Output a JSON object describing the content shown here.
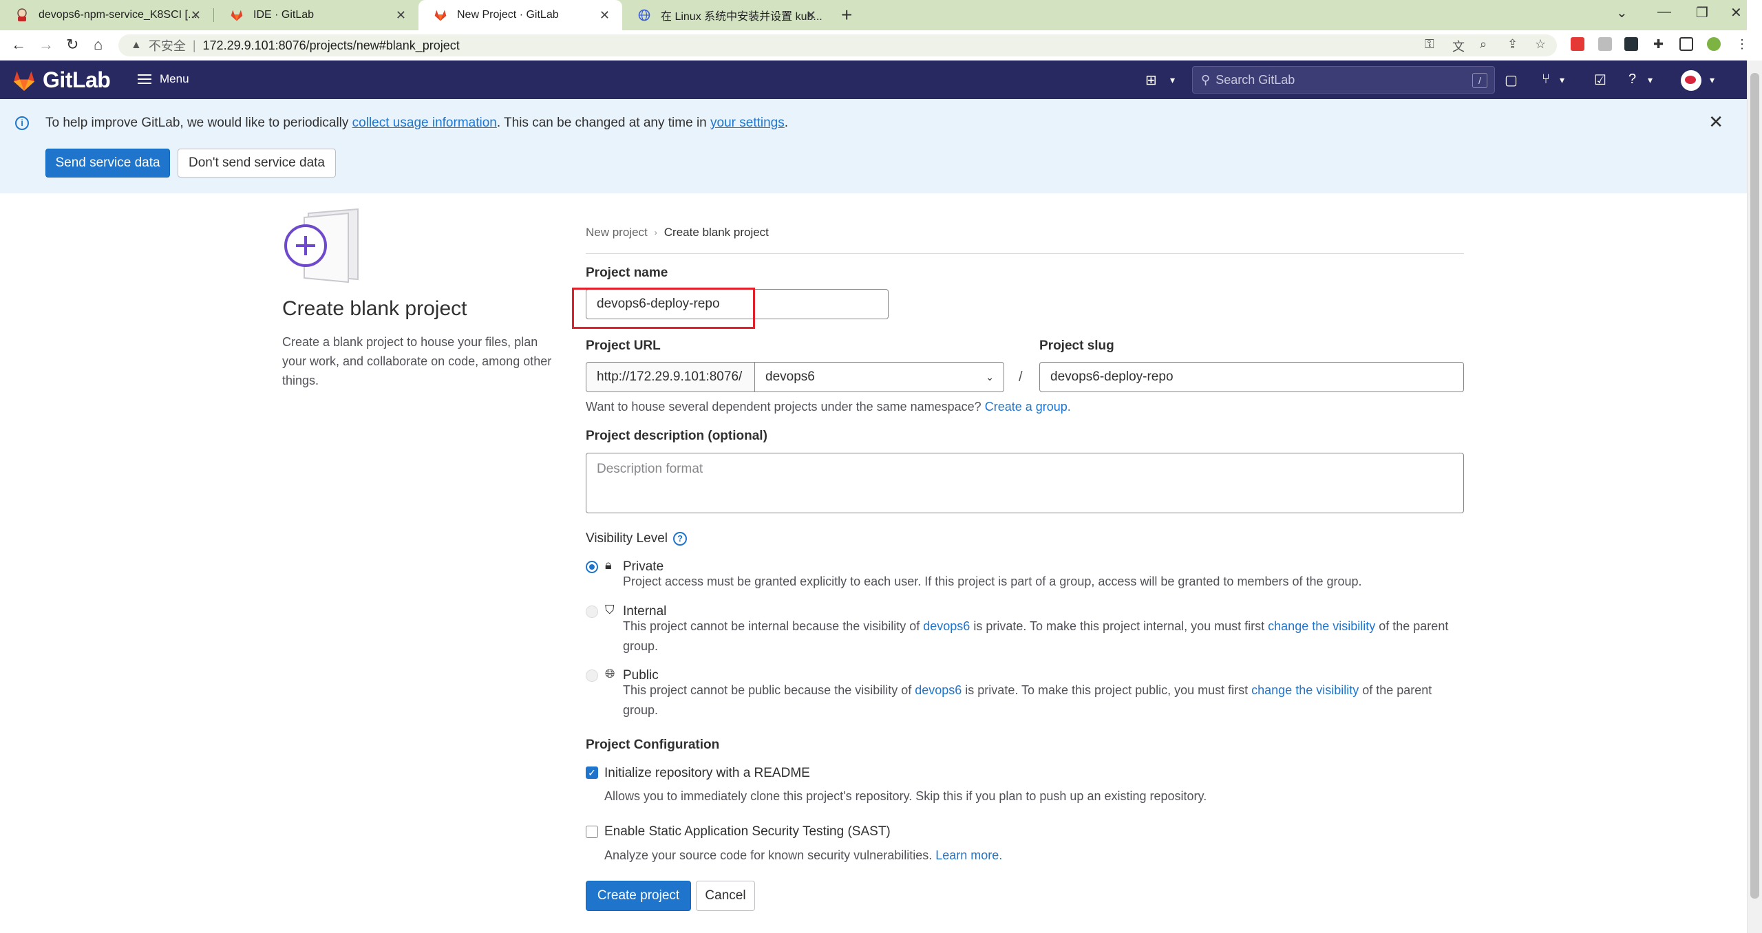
{
  "browser": {
    "tabs": [
      {
        "title": "devops6-npm-service_K8SCI [...",
        "icon": "jenkins-icon"
      },
      {
        "title": "IDE · GitLab",
        "icon": "gitlab-icon"
      },
      {
        "title": "New Project · GitLab",
        "icon": "gitlab-icon"
      },
      {
        "title": "在 Linux 系统中安装并设置 kub...",
        "icon": "globe-icon"
      }
    ],
    "address": {
      "security_label": "不安全",
      "separator": "|",
      "url": "172.29.9.101:8076/projects/new#blank_project"
    }
  },
  "gitlab_header": {
    "brand": "GitLab",
    "menu_label": "Menu",
    "search_placeholder": "Search GitLab",
    "search_shortcut": "/"
  },
  "banner": {
    "text_before": "To help improve GitLab, we would like to periodically ",
    "link1": "collect usage information",
    "text_middle": ". This can be changed at any time in ",
    "link2": "your settings",
    "text_after": ".",
    "send_button": "Send service data",
    "dont_send_button": "Don't send service data",
    "close": "✕"
  },
  "left_panel": {
    "title": "Create blank project",
    "description": "Create a blank project to house your files, plan your work, and collaborate on code, among other things."
  },
  "breadcrumb": {
    "parent": "New project",
    "current": "Create blank project"
  },
  "form": {
    "project_name_label": "Project name",
    "project_name_value": "devops6-deploy-repo",
    "project_url_label": "Project URL",
    "url_prefix": "http://172.29.9.101:8076/",
    "namespace_value": "devops6",
    "url_separator": "/",
    "project_slug_label": "Project slug",
    "project_slug_value": "devops6-deploy-repo",
    "namespace_help": "Want to house several dependent projects under the same namespace?",
    "create_group_link": "Create a group.",
    "description_label": "Project description (optional)",
    "description_placeholder": "Description format",
    "visibility_label": "Visibility Level",
    "visibility_help_icon": "?",
    "visibility": {
      "private": {
        "label": "Private",
        "desc": "Project access must be granted explicitly to each user. If this project is part of a group, access will be granted to members of the group."
      },
      "internal": {
        "label": "Internal",
        "desc_before": "This project cannot be internal because the visibility of ",
        "group_link": "devops6",
        "desc_middle": " is private. To make this project internal, you must first ",
        "change_link": "change the visibility",
        "desc_after": " of the parent group."
      },
      "public": {
        "label": "Public",
        "desc_before": "This project cannot be public because the visibility of ",
        "group_link": "devops6",
        "desc_middle": " is private. To make this project public, you must first ",
        "change_link": "change the visibility",
        "desc_after": " of the parent group."
      }
    },
    "config_label": "Project Configuration",
    "readme_label": "Initialize repository with a README",
    "readme_desc": "Allows you to immediately clone this project's repository. Skip this if you plan to push up an existing repository.",
    "readme_checked": true,
    "sast_label": "Enable Static Application Security Testing (SAST)",
    "sast_desc": "Analyze your source code for known security vulnerabilities.",
    "sast_learn_more": "Learn more.",
    "sast_checked": false,
    "create_button": "Create project",
    "cancel_button": "Cancel"
  },
  "colors": {
    "header_bg": "#292961",
    "primary": "#1f75cb",
    "banner_bg": "#e9f3fc",
    "highlight": "#e0202b"
  }
}
